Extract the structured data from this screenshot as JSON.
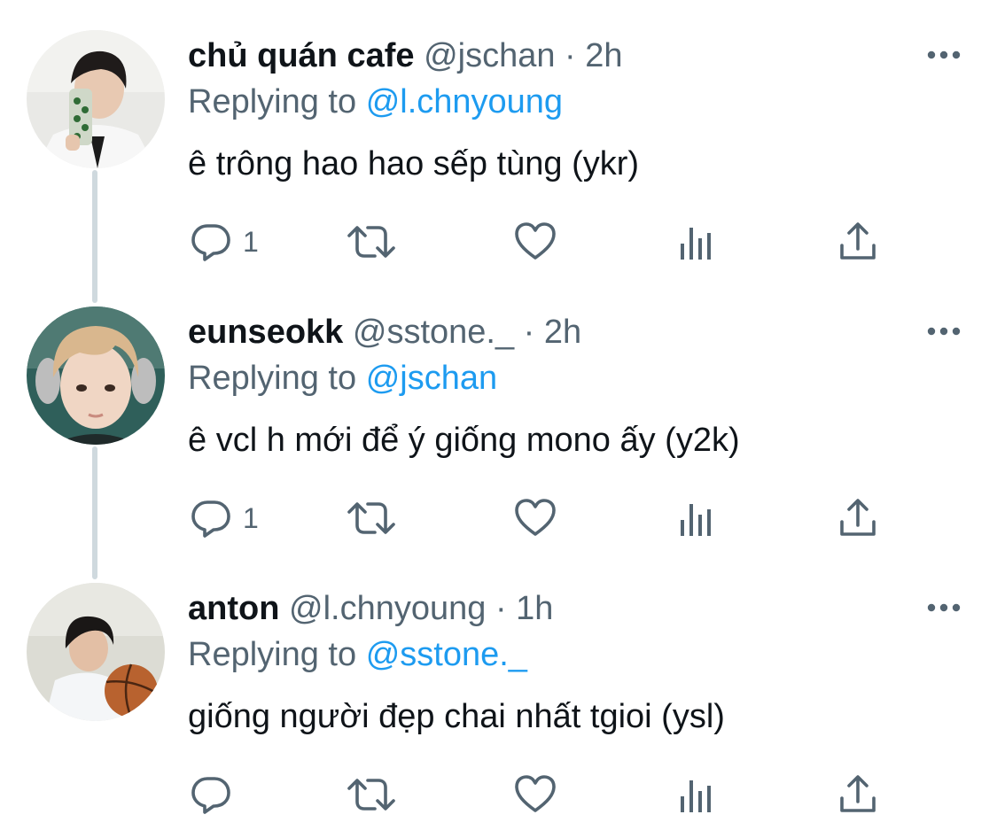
{
  "tweets": [
    {
      "display_name": "chủ quán cafe",
      "handle": "@jschan",
      "separator": "·",
      "time": "2h",
      "replying_prefix": "Replying to",
      "replying_to": "@l.chnyoung",
      "text": "ê trông hao hao sếp tùng (ykr)",
      "reply_count": "1",
      "avatar": "selfie-with-phone"
    },
    {
      "display_name": "eunseokk",
      "handle": "@sstone._",
      "separator": "·",
      "time": "2h",
      "replying_prefix": "Replying to",
      "replying_to": "@jschan",
      "text": "ê vcl h mới để ý giống mono ấy (y2k)",
      "reply_count": "1",
      "avatar": "blond-selfie"
    },
    {
      "display_name": "anton",
      "handle": "@l.chnyoung",
      "separator": "·",
      "time": "1h",
      "replying_prefix": "Replying to",
      "replying_to": "@sstone._",
      "text": "giống người đẹp chai nhất tgioi (ysl)",
      "reply_count": "",
      "avatar": "basketball-photo"
    }
  ],
  "icons": {
    "more": "more-horizontal-icon",
    "reply": "reply-bubble-icon",
    "retweet": "retweet-icon",
    "like": "heart-icon",
    "views": "views-bar-chart-icon",
    "share": "share-upload-icon"
  },
  "colors": {
    "text_primary": "#0f1419",
    "text_secondary": "#536471",
    "mention_blue": "#1d9bf0",
    "thread_line": "#cfd9de"
  }
}
